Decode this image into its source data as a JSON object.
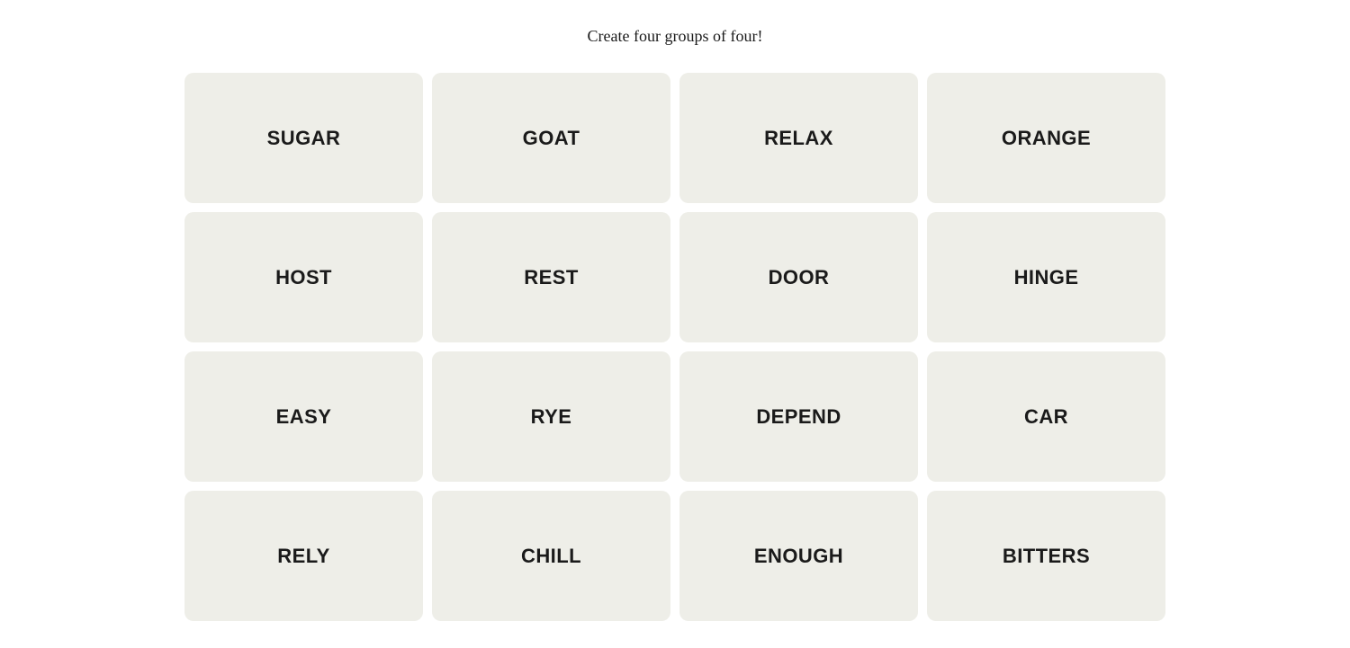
{
  "subtitle": "Create four groups of four!",
  "grid": {
    "tiles": [
      {
        "id": "sugar",
        "label": "SUGAR"
      },
      {
        "id": "goat",
        "label": "GOAT"
      },
      {
        "id": "relax",
        "label": "RELAX"
      },
      {
        "id": "orange",
        "label": "ORANGE"
      },
      {
        "id": "host",
        "label": "HOST"
      },
      {
        "id": "rest",
        "label": "REST"
      },
      {
        "id": "door",
        "label": "DOOR"
      },
      {
        "id": "hinge",
        "label": "HINGE"
      },
      {
        "id": "easy",
        "label": "EASY"
      },
      {
        "id": "rye",
        "label": "RYE"
      },
      {
        "id": "depend",
        "label": "DEPEND"
      },
      {
        "id": "car",
        "label": "CAR"
      },
      {
        "id": "rely",
        "label": "RELY"
      },
      {
        "id": "chill",
        "label": "CHILL"
      },
      {
        "id": "enough",
        "label": "ENOUGH"
      },
      {
        "id": "bitters",
        "label": "BITTERS"
      }
    ]
  }
}
